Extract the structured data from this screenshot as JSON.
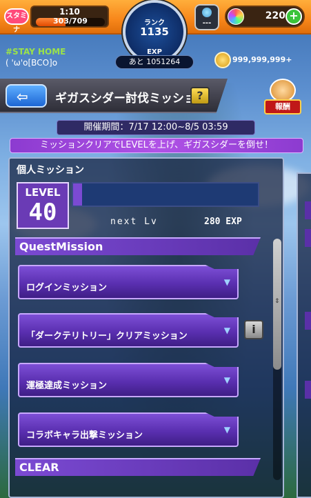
{
  "top_bar": {
    "stamina_label": "スタミナ",
    "stamina_time": "1:10",
    "stamina_count": "303/709",
    "stamina_fill": 0.43,
    "rank_label": "ランク",
    "rank_value": "1135",
    "exp_label": "EXP",
    "exp_remaining": "あと 1051264",
    "hub_text": "---",
    "orb_count": "220",
    "plus_icon": "plus-icon"
  },
  "user": {
    "tag": "#STAY HOME",
    "name": "( 'ω'o[BCO]o",
    "coin_count": "999,999,999+"
  },
  "header": {
    "title": "ギガスシダー討伐ミッション",
    "help_label": "?",
    "reward_label": "報酬"
  },
  "event": {
    "period": "開催期間：7/17 12:00~8/5 03:59",
    "banner": "ミッションクリアでLEVELを上げ、ギガスシダーを倒せ！"
  },
  "panel": {
    "title": "個人ミッション",
    "level_label": "LEVEL",
    "level_value": "40",
    "level_progress": 0.05,
    "next_label": "next Lv",
    "next_exp": "280 EXP",
    "quest_header": "QuestMission",
    "missions": [
      {
        "label": "ログインミッション"
      },
      {
        "label": "「ダークテリトリー」クリアミッション"
      },
      {
        "label": "運極達成ミッション"
      },
      {
        "label": "コラボキャラ出撃ミッション"
      }
    ],
    "clear_header": "CLEAR",
    "info_label": "i"
  },
  "colors": {
    "accent_purple": "#7b4ad3",
    "top_orange": "#f7861a",
    "tag_green": "#9be24a"
  }
}
